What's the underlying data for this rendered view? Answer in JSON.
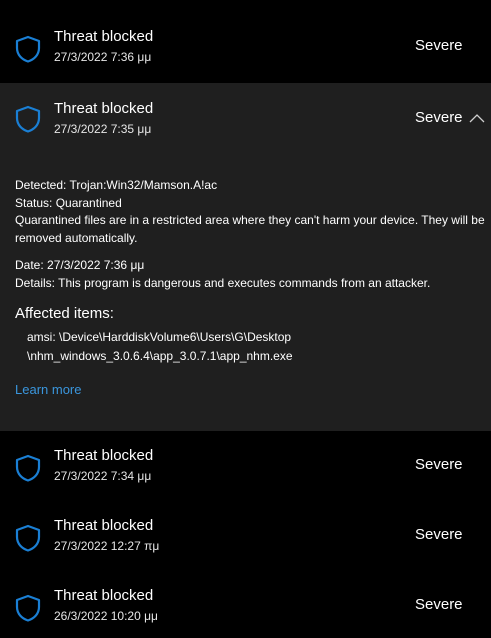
{
  "colors": {
    "background": "#000000",
    "expanded_background": "#1f1f1f",
    "accent": "#3a96dd",
    "icon": "#1a7fd4"
  },
  "threats": [
    {
      "title": "Threat blocked",
      "date": "27/3/2022 7:36 μμ",
      "severity": "Severe",
      "icon": "shield-icon"
    },
    {
      "title": "Threat blocked",
      "date": "27/3/2022 7:35 μμ",
      "severity": "Severe",
      "icon": "shield-icon",
      "expanded": true,
      "toggle_icon": "chevron-up-icon"
    },
    {
      "title": "Threat blocked",
      "date": "27/3/2022 7:34 μμ",
      "severity": "Severe",
      "icon": "shield-icon"
    },
    {
      "title": "Threat blocked",
      "date": "27/3/2022 12:27 πμ",
      "severity": "Severe",
      "icon": "shield-icon"
    },
    {
      "title": "Threat blocked",
      "date": "26/3/2022 10:20 μμ",
      "severity": "Severe",
      "icon": "shield-icon"
    }
  ],
  "details": {
    "detected_label": "Detected:",
    "detected_value": "Trojan:Win32/Mamson.A!ac",
    "status_label": "Status:",
    "status_value": "Quarantined",
    "status_note": "Quarantined files are in a restricted area where they can't harm your device. They will be removed automatically.",
    "date_label": "Date:",
    "date_value": "27/3/2022 7:36 μμ",
    "details_label": "Details:",
    "details_value": "This program is dangerous and executes commands from an attacker.",
    "affected_title": "Affected items:",
    "affected_line1": "amsi: \\Device\\HarddiskVolume6\\Users\\G\\Desktop",
    "affected_line2": "\\nhm_windows_3.0.6.4\\app_3.0.7.1\\app_nhm.exe",
    "learn_more": "Learn more"
  }
}
